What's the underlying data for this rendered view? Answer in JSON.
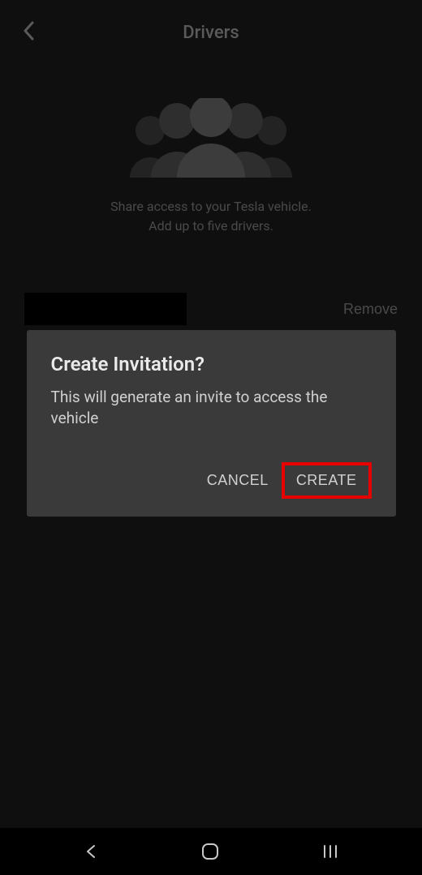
{
  "header": {
    "title": "Drivers"
  },
  "hero": {
    "line1": "Share access to your Tesla vehicle.",
    "line2": "Add up to five drivers."
  },
  "driver_row": {
    "remove_label": "Remove"
  },
  "dialog": {
    "title": "Create Invitation?",
    "message": "This will generate an invite to access the vehicle",
    "cancel_label": "CANCEL",
    "create_label": "CREATE"
  }
}
